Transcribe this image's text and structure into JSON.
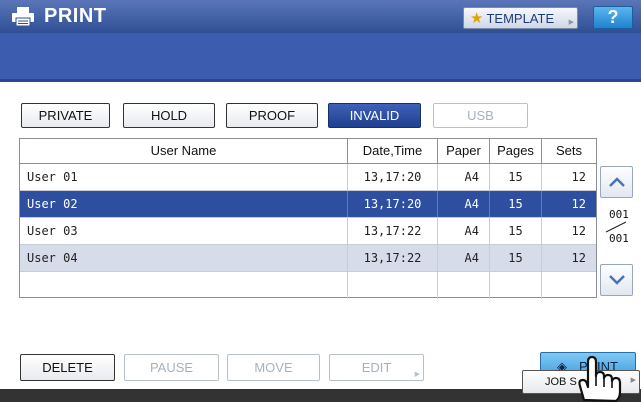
{
  "header": {
    "title": "PRINT",
    "template_label": "TEMPLATE",
    "help_label": "?"
  },
  "tabs": [
    {
      "label": "PRIVATE",
      "state": "normal"
    },
    {
      "label": "HOLD",
      "state": "normal"
    },
    {
      "label": "PROOF",
      "state": "normal"
    },
    {
      "label": "INVALID",
      "state": "active"
    },
    {
      "label": "USB",
      "state": "disabled"
    }
  ],
  "table": {
    "columns": [
      "User Name",
      "Date,Time",
      "Paper",
      "Pages",
      "Sets"
    ],
    "rows": [
      {
        "user": "User 01",
        "datetime": "13,17:20",
        "paper": "A4",
        "pages": "15",
        "sets": "12",
        "state": "normal"
      },
      {
        "user": "User 02",
        "datetime": "13,17:20",
        "paper": "A4",
        "pages": "15",
        "sets": "12",
        "state": "selected"
      },
      {
        "user": "User 03",
        "datetime": "13,17:22",
        "paper": "A4",
        "pages": "15",
        "sets": "12",
        "state": "normal"
      },
      {
        "user": "User 04",
        "datetime": "13,17:22",
        "paper": "A4",
        "pages": "15",
        "sets": "12",
        "state": "shaded"
      }
    ]
  },
  "pagination": {
    "current": "001",
    "total": "001"
  },
  "actions": {
    "delete": "DELETE",
    "pause": "PAUSE",
    "move": "MOVE",
    "edit": "EDIT",
    "print": "PRINT"
  },
  "footer": {
    "job_status": "JOB S"
  },
  "colors": {
    "title_bar": "#2f4f95",
    "band": "#3c5cb0",
    "selected_row": "#2e4f9f",
    "print_button": "#3e9ad9"
  }
}
